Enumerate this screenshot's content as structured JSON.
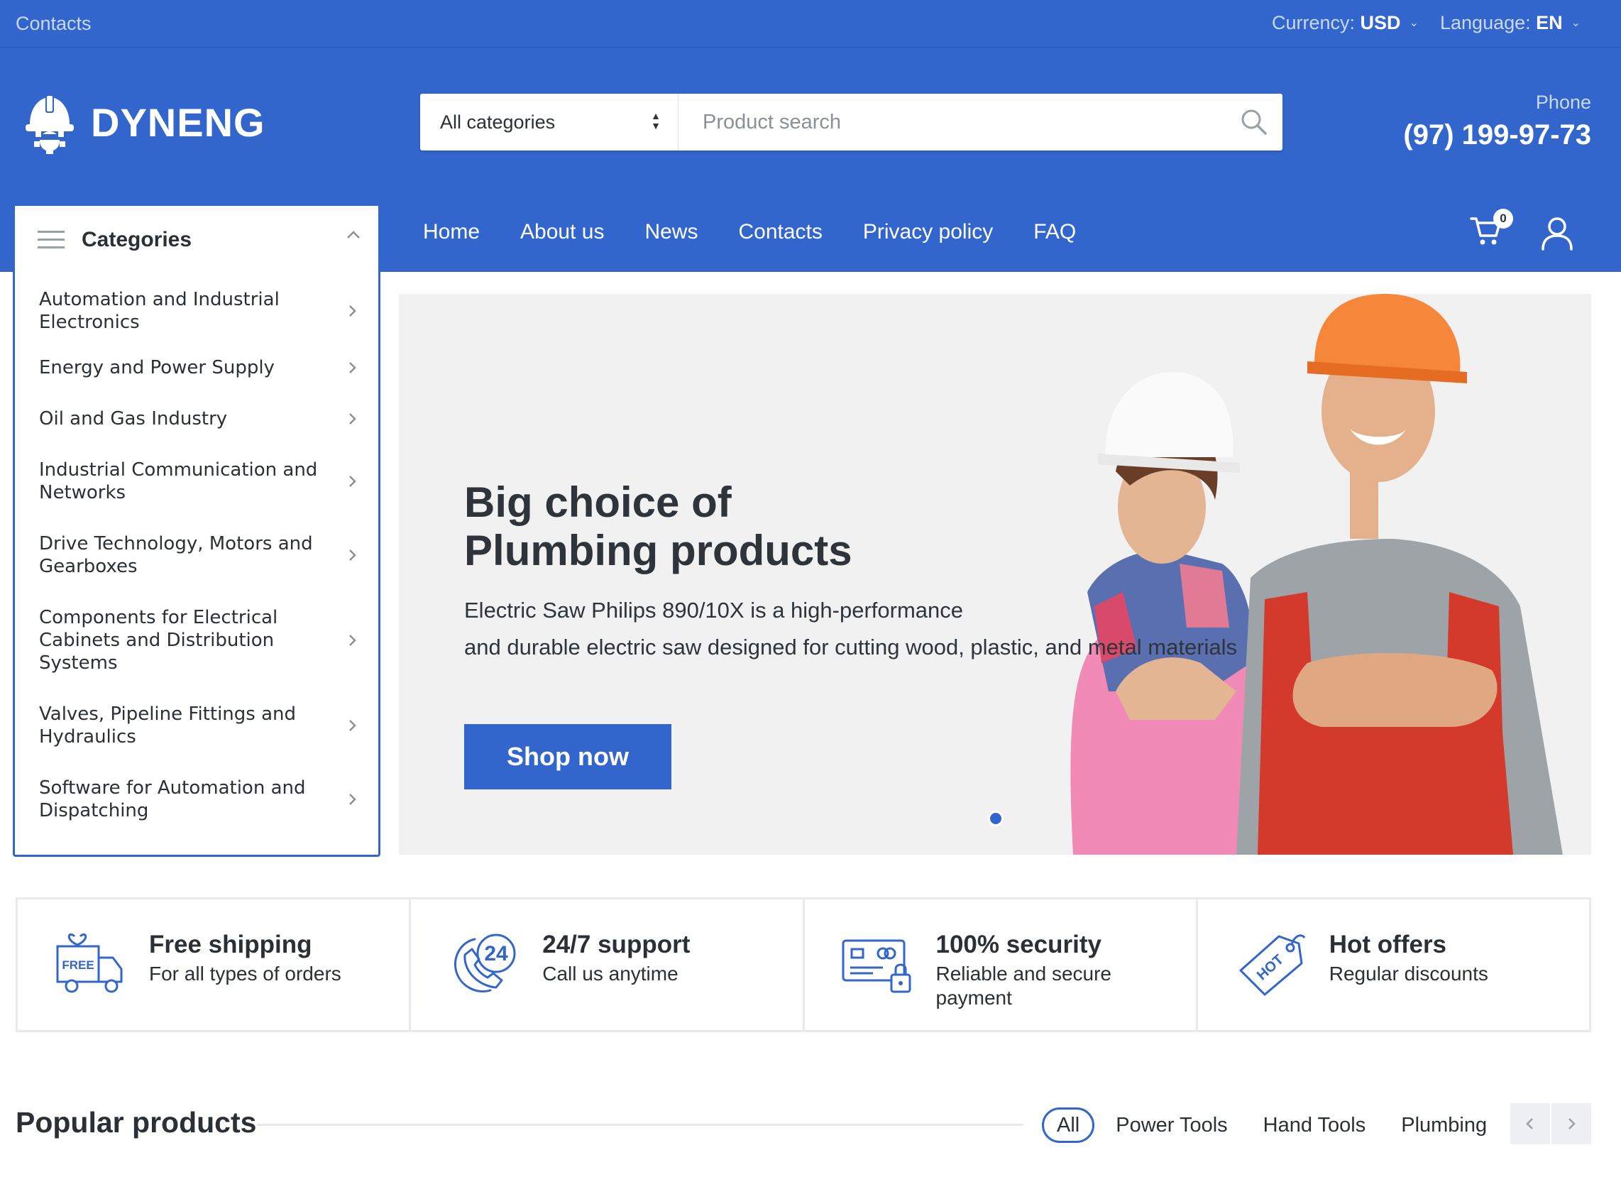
{
  "topbar": {
    "contacts": "Contacts",
    "currency_label": "Currency:",
    "currency_value": "USD",
    "language_label": "Language:",
    "language_value": "EN"
  },
  "header": {
    "brand": "DYNENG",
    "category_select": "All categories",
    "search_placeholder": "Product search",
    "phone_label": "Phone",
    "phone_number": "(97) 199-97-73"
  },
  "nav": {
    "items": [
      "Home",
      "About us",
      "News",
      "Contacts",
      "Privacy policy",
      "FAQ"
    ],
    "cart_count": "0"
  },
  "categories": {
    "title": "Categories",
    "items": [
      "Automation and Industrial Electronics",
      "Energy and Power Supply",
      "Oil and Gas Industry",
      "Industrial Communication and Networks",
      "Drive Technology, Motors and Gearboxes",
      "Components for Electrical Cabinets and Distribution Systems",
      "Valves, Pipeline Fittings and Hydraulics",
      "Software for Automation and Dispatching"
    ]
  },
  "hero": {
    "title_line1": "Big choice of",
    "title_line2": "Plumbing products",
    "desc_line1": "Electric Saw Philips 890/10X is a high-performance",
    "desc_line2": "and durable electric saw designed for cutting wood, plastic, and metal materials",
    "button": "Shop now"
  },
  "features": [
    {
      "title": "Free shipping",
      "subtitle": "For all types of orders",
      "icon": "free-delivery-truck-icon",
      "badge": "FREE"
    },
    {
      "title": "24/7 support",
      "subtitle": "Call us anytime",
      "icon": "support-24-phone-icon",
      "badge": "24"
    },
    {
      "title": "100% security",
      "subtitle": "Reliable and secure payment",
      "icon": "secure-payment-card-icon"
    },
    {
      "title": "Hot offers",
      "subtitle": "Regular discounts",
      "icon": "hot-tag-icon",
      "badge": "HOT"
    }
  ],
  "popular": {
    "title": "Popular products",
    "tabs": [
      "All",
      "Power Tools",
      "Hand Tools",
      "Plumbing"
    ]
  },
  "colors": {
    "brand_blue": "#3366cc",
    "text_dark": "#2b2f36",
    "hero_bg": "#f1f1f1"
  }
}
